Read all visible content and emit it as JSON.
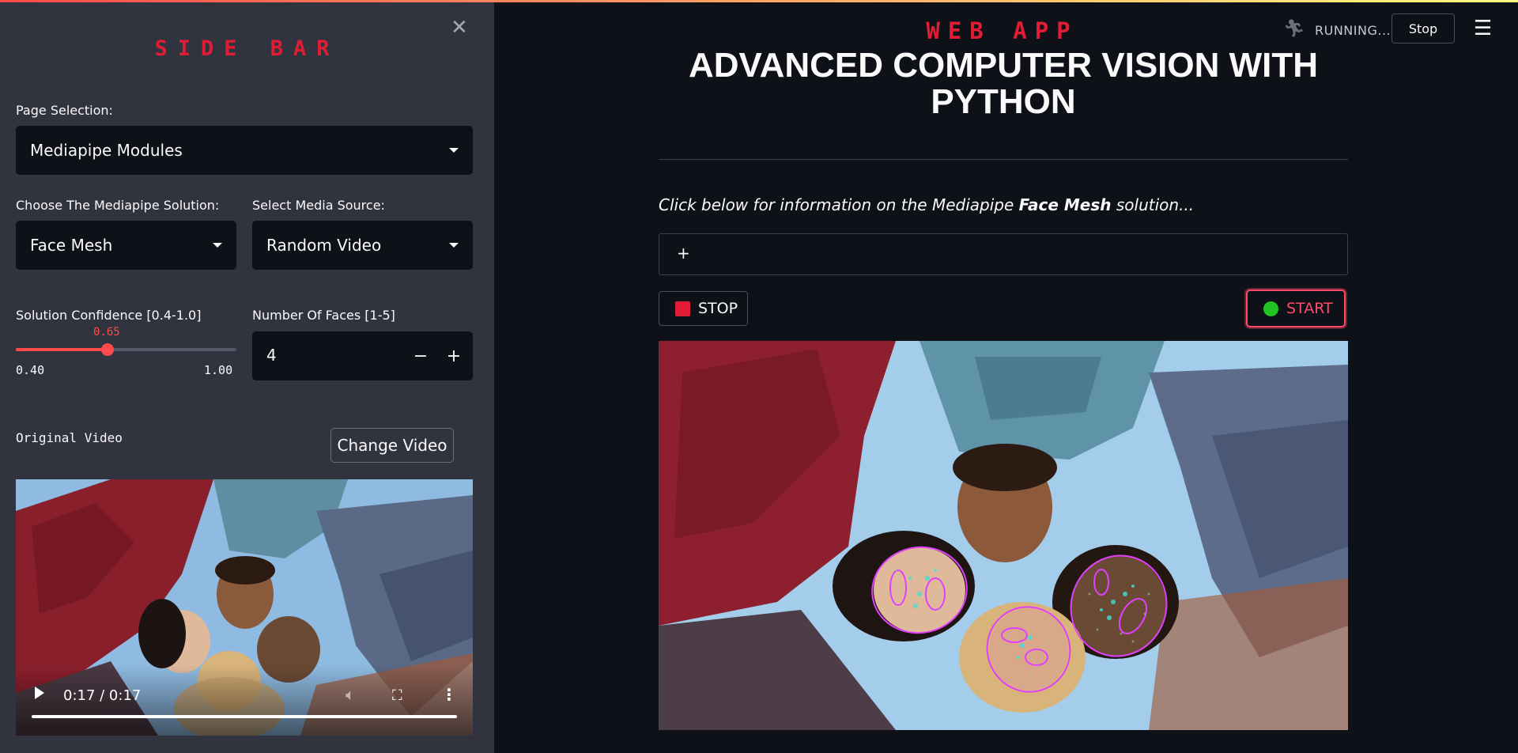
{
  "header": {
    "status_text": "RUNNING...",
    "stop_label": "Stop",
    "menu_icon": "hamburger-menu-icon",
    "running_icon": "running-person-icon"
  },
  "sidebar": {
    "title": "SIDE BAR",
    "page_selection_label": "Page Selection:",
    "page_selection_value": "Mediapipe Modules",
    "solution_label": "Choose The Mediapipe Solution:",
    "solution_value": "Face Mesh",
    "media_source_label": "Select Media Source:",
    "media_source_value": "Random Video",
    "confidence_label": "Solution Confidence [0.4-1.0]",
    "confidence_value": "0.65",
    "confidence_min": "0.40",
    "confidence_max": "1.00",
    "confidence_fraction": 0.4167,
    "faces_label": "Number Of Faces [1-5]",
    "faces_value": "4",
    "original_video_label": "Original Video",
    "change_video_label": "Change Video",
    "video_time": "0:17 / 0:17"
  },
  "main": {
    "webapp_title": "WEB APP",
    "heading": "ADVANCED COMPUTER VISION WITH PYTHON",
    "info_prefix": "Click below for information on the Mediapipe ",
    "info_bold": "Face Mesh",
    "info_suffix": " solution...",
    "expander_symbol": "+",
    "stop_label": "STOP",
    "start_label": "START"
  },
  "colors": {
    "accent_red": "#e11d35",
    "slider_red": "#ff4b4b",
    "start_green": "#21c421",
    "mesh_magenta": "#e040fb",
    "mesh_cyan": "#40e0d0"
  }
}
